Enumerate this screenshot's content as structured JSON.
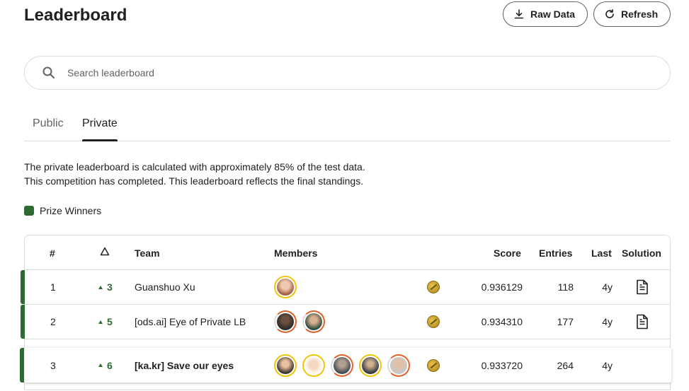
{
  "header": {
    "title": "Leaderboard",
    "raw_data_label": "Raw Data",
    "refresh_label": "Refresh"
  },
  "search": {
    "placeholder": "Search leaderboard"
  },
  "tabs": [
    {
      "label": "Public"
    },
    {
      "label": "Private",
      "active": true
    }
  ],
  "description": {
    "line1": "The private leaderboard is calculated with approximately 85% of the test data.",
    "line2": "This competition has completed. This leaderboard reflects the final standings."
  },
  "legend": {
    "label": "Prize Winners",
    "color": "#2e6b30"
  },
  "table": {
    "columns": {
      "rank": "#",
      "team": "Team",
      "members": "Members",
      "score": "Score",
      "entries": "Entries",
      "last": "Last",
      "solution": "Solution"
    },
    "rows": [
      {
        "rank": "1",
        "delta": "3",
        "team": "Guanshuo Xu",
        "score": "0.936129",
        "entries": "118",
        "last": "4y",
        "members": 1,
        "solution": true
      },
      {
        "rank": "2",
        "delta": "5",
        "team": "[ods.ai] Eye of Private LB",
        "score": "0.934310",
        "entries": "177",
        "last": "4y",
        "members": 2,
        "solution": true
      },
      {
        "rank": "3",
        "delta": "6",
        "team": "[ka.kr] Save our eyes",
        "score": "0.933720",
        "entries": "264",
        "last": "4y",
        "members": 5,
        "solution": false
      }
    ]
  },
  "colors": {
    "prize": "#2e6b30",
    "gold_medal": "#c9a227",
    "tier_gold": "#f1c40f",
    "tier_orange": "#e0622a"
  }
}
